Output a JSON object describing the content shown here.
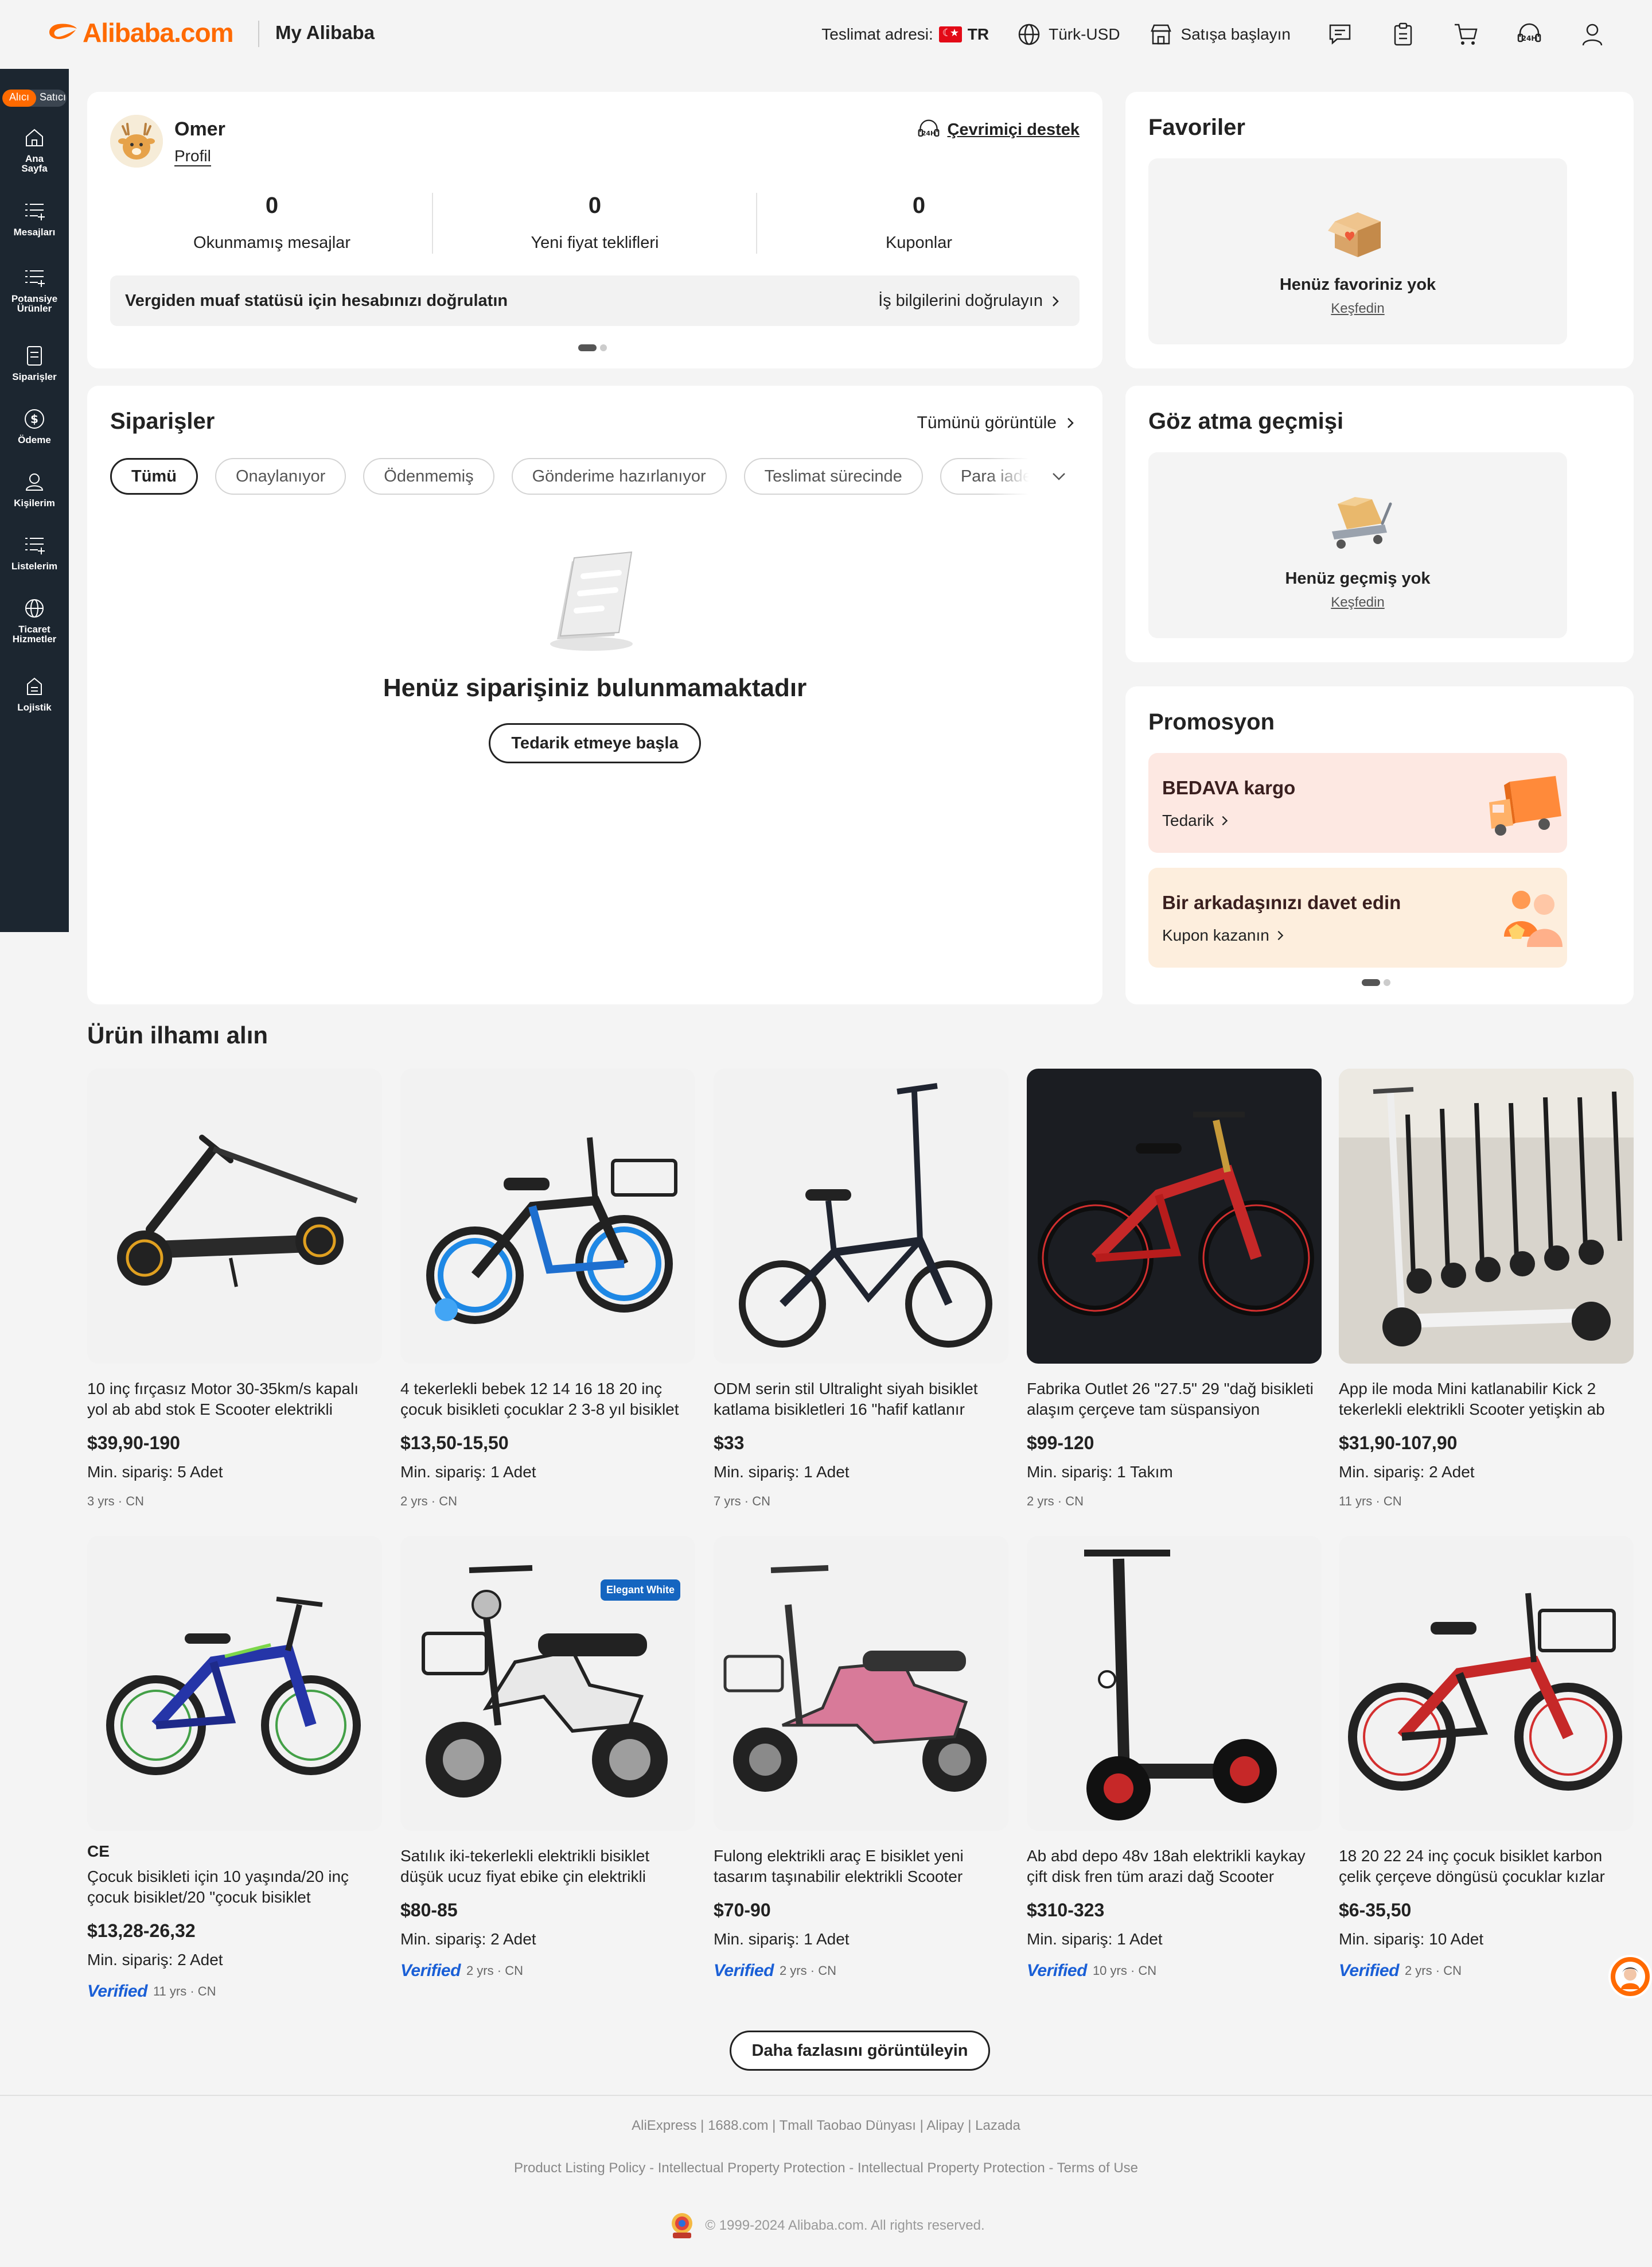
{
  "header": {
    "logo_text": "Alibaba.com",
    "section_title": "My Alibaba",
    "delivery_label": "Teslimat adresi:",
    "delivery_country": "TR",
    "language_currency": "Türk-USD",
    "sell_label": "Satışa başlayın",
    "icons": [
      "messages-icon",
      "orders-icon",
      "cart-icon",
      "support-24h-icon",
      "account-icon"
    ]
  },
  "sidebar": {
    "role_active": "Alıcı",
    "role_inactive": "Satıcı",
    "items": [
      {
        "label_1": "Ana",
        "label_2": "Sayfa",
        "icon": "home-icon"
      },
      {
        "label_1": "Mesajları",
        "label_2": "",
        "icon": "messages-list-icon"
      },
      {
        "label_1": "Potansiye",
        "label_2": "Ürünler",
        "icon": "potential-products-icon"
      },
      {
        "label_1": "Siparişler",
        "label_2": "",
        "icon": "orders-icon"
      },
      {
        "label_1": "Ödeme",
        "label_2": "",
        "icon": "payment-icon"
      },
      {
        "label_1": "Kişilerim",
        "label_2": "",
        "icon": "contacts-icon"
      },
      {
        "label_1": "Listelerim",
        "label_2": "",
        "icon": "lists-icon"
      },
      {
        "label_1": "Ticaret",
        "label_2": "Hizmetler",
        "icon": "globe-icon"
      },
      {
        "label_1": "Lojistik",
        "label_2": "",
        "icon": "logistics-icon"
      }
    ]
  },
  "profile": {
    "name": "Omer",
    "profile_link": "Profil",
    "support_label": "Çevrimiçi destek",
    "stats": [
      {
        "value": "0",
        "label": "Okunmamış mesajlar"
      },
      {
        "value": "0",
        "label": "Yeni fiyat teklifleri"
      },
      {
        "value": "0",
        "label": "Kuponlar"
      }
    ],
    "verify_text": "Vergiden muaf statüsü için hesabınızı doğrulatın",
    "verify_action": "İş bilgilerini doğrulayın"
  },
  "favorites": {
    "title": "Favoriler",
    "empty_text": "Henüz favoriniz yok",
    "explore": "Keşfedin"
  },
  "orders": {
    "title": "Siparişler",
    "view_all": "Tümünü görüntüle",
    "tabs": [
      "Tümü",
      "Onaylanıyor",
      "Ödenmemiş",
      "Gönderime hazırlanıyor",
      "Teslimat sürecinde",
      "Para iade"
    ],
    "empty_text": "Henüz siparişiniz bulunmamaktadır",
    "start_button": "Tedarik etmeye başla"
  },
  "history": {
    "title": "Göz atma geçmişi",
    "empty_text": "Henüz geçmiş yok",
    "explore": "Keşfedin"
  },
  "promotion": {
    "title": "Promosyon",
    "items": [
      {
        "title": "BEDAVA kargo",
        "action": "Tedarik"
      },
      {
        "title": "Bir arkadaşınızı davet edin",
        "action": "Kupon kazanın"
      }
    ]
  },
  "inspiration": {
    "title": "Ürün ilhamı alın",
    "products": [
      {
        "title": "10 inç fırçasız Motor 30-35km/s kapalı yol ab abd stok E Scooter elektrikli scooter",
        "price": "$39,90-190",
        "moq": "Min. sipariş: 5 Adet",
        "verified": "",
        "years": "3 yrs",
        "country": "CN",
        "ce": ""
      },
      {
        "title": "4 tekerlekli bebek 12 14 16 18 20 inç çocuk bisikleti çocuklar 2 3-8 yıl bisiklet",
        "price": "$13,50-15,50",
        "moq": "Min. sipariş: 1 Adet",
        "verified": "",
        "years": "2 yrs",
        "country": "CN",
        "ce": ""
      },
      {
        "title": "ODM serin stil Ultralight siyah bisiklet katlama bisikletleri 16 \"hafif katlanır bisiklet",
        "price": "$33",
        "moq": "Min. sipariş: 1 Adet",
        "verified": "",
        "years": "7 yrs",
        "country": "CN",
        "ce": ""
      },
      {
        "title": "Fabrika Outlet 26 \"27.5\" 29 \"dağ bisikleti alaşım çerçeve tam süspansiyon",
        "price": "$99-120",
        "moq": "Min. sipariş: 1 Takım",
        "verified": "",
        "years": "2 yrs",
        "country": "CN",
        "ce": ""
      },
      {
        "title": "App ile moda Mini katlanabilir Kick 2 tekerlekli elektrikli Scooter yetişkin ab depo",
        "price": "$31,90-107,90",
        "moq": "Min. sipariş: 2 Adet",
        "verified": "",
        "years": "11 yrs",
        "country": "CN",
        "ce": ""
      },
      {
        "title": "Çocuk bisikleti için 10 yaşında/20 inç çocuk bisiklet/20 \"çocuk bisiklet",
        "price": "$13,28-26,32",
        "moq": "Min. sipariş: 2 Adet",
        "verified": "Verified",
        "years": "11 yrs",
        "country": "CN",
        "ce": "CE"
      },
      {
        "title": "Satılık iki-tekerlekli elektrikli bisiklet düşük ucuz fiyat ebike çin elektrikli bisiklet",
        "price": "$80-85",
        "moq": "Min. sipariş: 2 Adet",
        "verified": "Verified",
        "years": "2 yrs",
        "country": "CN",
        "ce": "",
        "badge": "Elegant White"
      },
      {
        "title": "Fulong elektrikli araç E bisiklet yeni tasarım taşınabilir elektrikli Scooter pedallı",
        "price": "$70-90",
        "moq": "Min. sipariş: 1 Adet",
        "verified": "Verified",
        "years": "2 yrs",
        "country": "CN",
        "ce": ""
      },
      {
        "title": "Ab abd depo 48v 18ah elektrikli kaykay çift disk fren tüm arazi dağ Scooter yetişkin",
        "price": "$310-323",
        "moq": "Min. sipariş: 1 Adet",
        "verified": "Verified",
        "years": "10 yrs",
        "country": "CN",
        "ce": ""
      },
      {
        "title": "18 20 22 24 inç çocuk bisiklet karbon çelik çerçeve döngüsü çocuklar kızlar bisiklet",
        "price": "$6-35,50",
        "moq": "Min. sipariş: 10 Adet",
        "verified": "Verified",
        "years": "2 yrs",
        "country": "CN",
        "ce": ""
      }
    ],
    "more_button": "Daha fazlasını görüntüleyin"
  },
  "footer": {
    "sites_line": "AliExpress | 1688.com | Tmall Taobao Dünyası | Alipay | Lazada",
    "policy_line": "Product Listing Policy - Intellectual Property Protection - Intellectual Property Protection - Terms of Use",
    "copyright": "© 1999-2024 Alibaba.com. All rights reserved."
  },
  "colors": {
    "brand": "#ff6a00",
    "sidebar": "#1c2630",
    "verified": "#1a5fd6",
    "page_bg": "#f4f4f4"
  }
}
